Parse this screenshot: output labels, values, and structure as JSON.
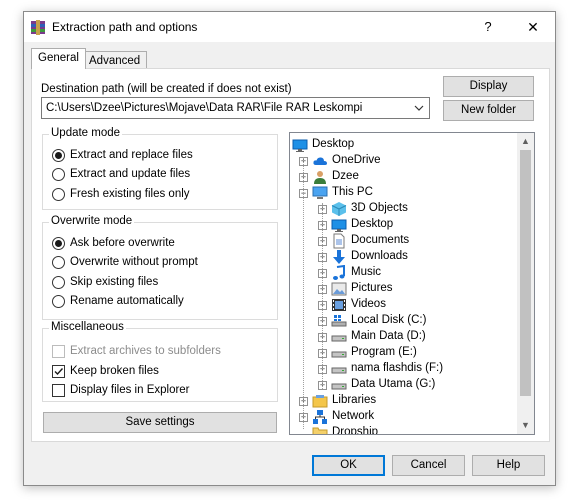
{
  "window": {
    "title": "Extraction path and options",
    "help_glyph": "?",
    "close_glyph": "✕"
  },
  "tabs": [
    {
      "label": "General",
      "active": true
    },
    {
      "label": "Advanced",
      "active": false
    }
  ],
  "destination": {
    "label": "Destination path (will be created if does not exist)",
    "value": "C:\\Users\\Dzee\\Pictures\\Mojave\\Data RAR\\File RAR Leskompi"
  },
  "buttons": {
    "display": "Display",
    "new_folder": "New folder",
    "save_settings": "Save settings",
    "ok": "OK",
    "cancel": "Cancel",
    "help": "Help"
  },
  "update_mode": {
    "title": "Update mode",
    "options": [
      {
        "label": "Extract and replace files",
        "selected": true
      },
      {
        "label": "Extract and update files",
        "selected": false
      },
      {
        "label": "Fresh existing files only",
        "selected": false
      }
    ]
  },
  "overwrite_mode": {
    "title": "Overwrite mode",
    "options": [
      {
        "label": "Ask before overwrite",
        "selected": true
      },
      {
        "label": "Overwrite without prompt",
        "selected": false
      },
      {
        "label": "Skip existing files",
        "selected": false
      },
      {
        "label": "Rename automatically",
        "selected": false
      }
    ]
  },
  "miscellaneous": {
    "title": "Miscellaneous",
    "options": [
      {
        "label": "Extract archives to subfolders",
        "checked": false,
        "disabled": true
      },
      {
        "label": "Keep broken files",
        "checked": true,
        "disabled": false
      },
      {
        "label": "Display files in Explorer",
        "checked": false,
        "disabled": false
      }
    ]
  },
  "tree": {
    "items": [
      {
        "label": "Desktop",
        "icon": "desktop-icon",
        "level": 0,
        "expander": "none"
      },
      {
        "label": "OneDrive",
        "icon": "cloud-icon",
        "level": 1,
        "expander": "plus"
      },
      {
        "label": "Dzee",
        "icon": "user-icon",
        "level": 1,
        "expander": "plus"
      },
      {
        "label": "This PC",
        "icon": "computer-icon",
        "level": 1,
        "expander": "minus"
      },
      {
        "label": "3D Objects",
        "icon": "cube-icon",
        "level": 2,
        "expander": "plus"
      },
      {
        "label": "Desktop",
        "icon": "desktop-icon",
        "level": 2,
        "expander": "plus"
      },
      {
        "label": "Documents",
        "icon": "document-icon",
        "level": 2,
        "expander": "plus"
      },
      {
        "label": "Downloads",
        "icon": "download-icon",
        "level": 2,
        "expander": "plus"
      },
      {
        "label": "Music",
        "icon": "music-icon",
        "level": 2,
        "expander": "plus"
      },
      {
        "label": "Pictures",
        "icon": "picture-icon",
        "level": 2,
        "expander": "plus"
      },
      {
        "label": "Videos",
        "icon": "video-icon",
        "level": 2,
        "expander": "plus"
      },
      {
        "label": "Local Disk (C:)",
        "icon": "system-drive-icon",
        "level": 2,
        "expander": "plus"
      },
      {
        "label": "Main Data (D:)",
        "icon": "drive-icon",
        "level": 2,
        "expander": "plus"
      },
      {
        "label": "Program (E:)",
        "icon": "drive-icon",
        "level": 2,
        "expander": "plus"
      },
      {
        "label": "nama flashdis (F:)",
        "icon": "drive-icon",
        "level": 2,
        "expander": "plus"
      },
      {
        "label": "Data Utama (G:)",
        "icon": "drive-icon",
        "level": 2,
        "expander": "plus"
      },
      {
        "label": "Libraries",
        "icon": "library-icon",
        "level": 1,
        "expander": "plus"
      },
      {
        "label": "Network",
        "icon": "network-icon",
        "level": 1,
        "expander": "plus"
      },
      {
        "label": "Dropship",
        "icon": "folder-icon",
        "level": 1,
        "expander": "none"
      }
    ]
  },
  "colors": {
    "accent": "#0078d7",
    "dialog_bg": "#f0f0f0"
  }
}
